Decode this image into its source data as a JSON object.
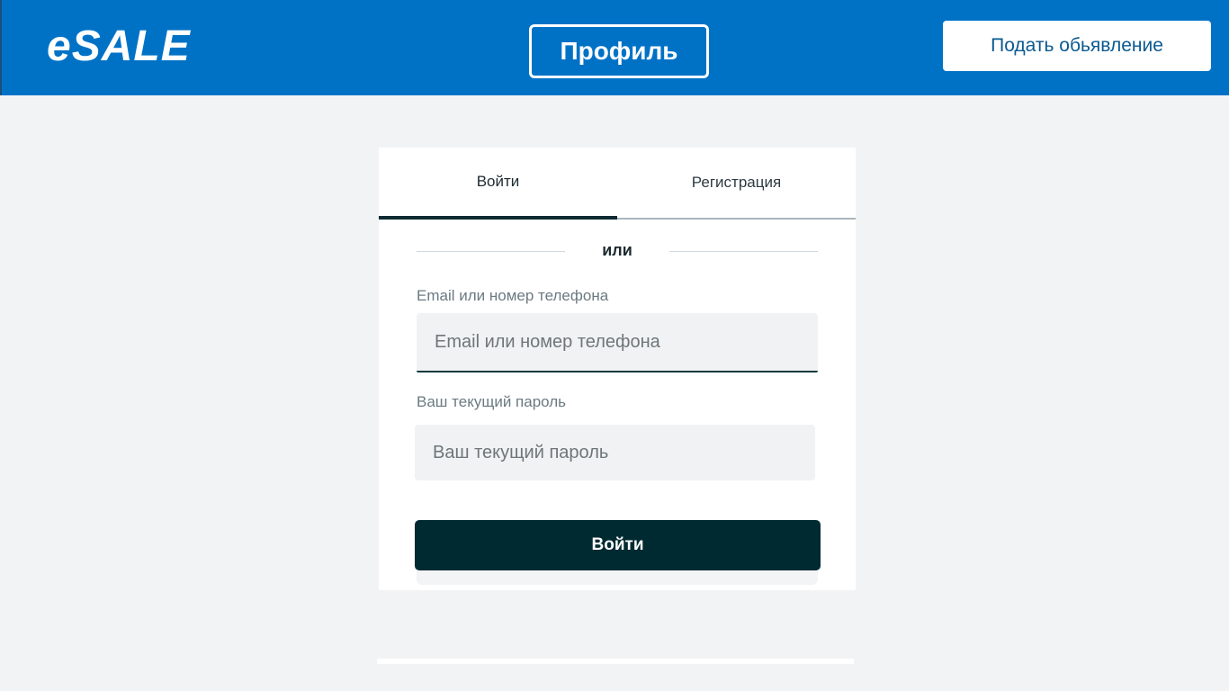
{
  "header": {
    "logo": "eSALE",
    "profile_label": "Профиль",
    "post_ad_label": "Подать обьявление"
  },
  "auth": {
    "tabs": [
      {
        "label": "Войти",
        "active": true
      },
      {
        "label": "Регистрация",
        "active": false
      }
    ],
    "divider_text": "или",
    "email": {
      "label": "Email или номер телефона",
      "placeholder": "Email или номер телефона",
      "value": ""
    },
    "password": {
      "label": "Ваш текущий пароль",
      "placeholder": "Ваш текущий пароль",
      "value": ""
    },
    "submit_label": "Войти"
  },
  "colors": {
    "header_bg": "#0072c6",
    "page_bg": "#f2f3f5",
    "button_dark": "#002a32",
    "input_bg": "#f1f2f3"
  }
}
